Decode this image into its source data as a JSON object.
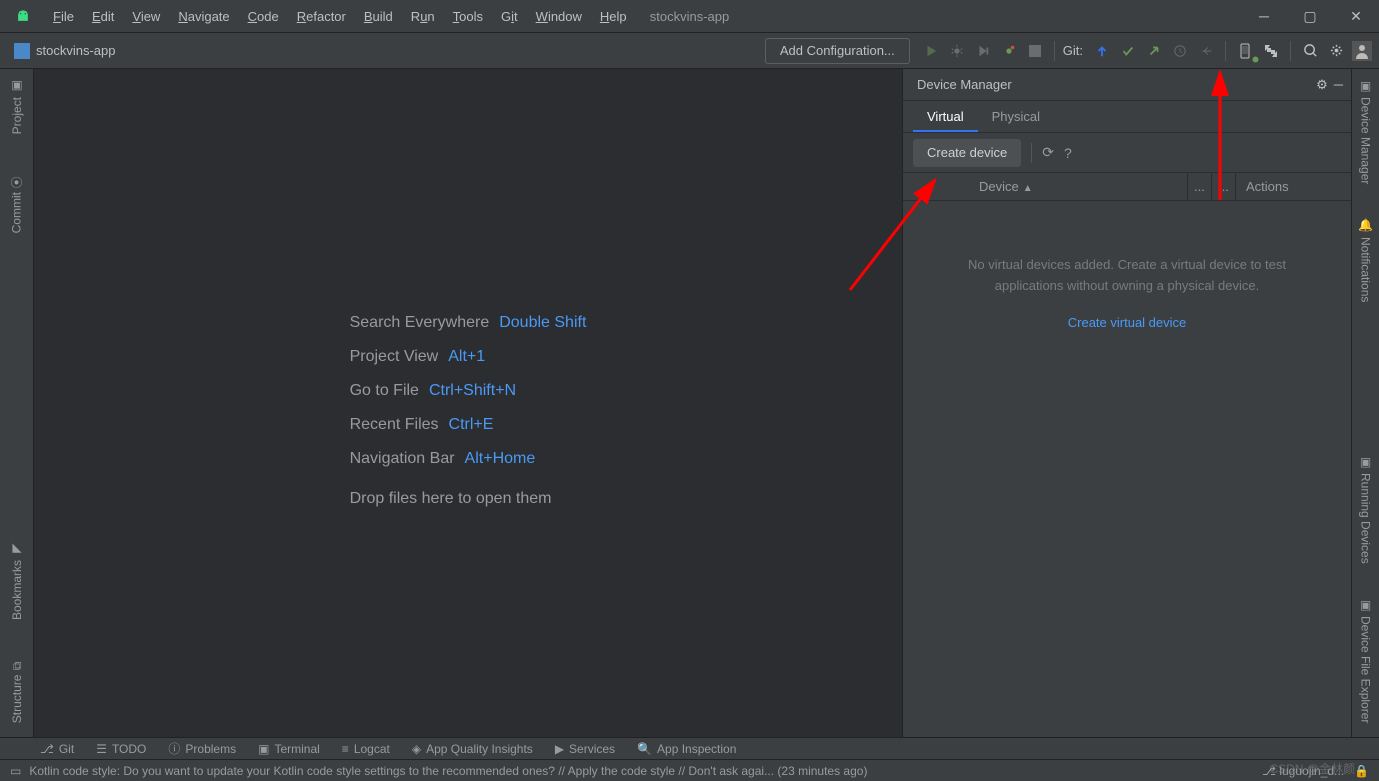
{
  "titlebar": {
    "project_title": "stockvins-app",
    "menus": [
      "File",
      "Edit",
      "View",
      "Navigate",
      "Code",
      "Refactor",
      "Build",
      "Run",
      "Tools",
      "Git",
      "Window",
      "Help"
    ]
  },
  "toolbar": {
    "project_name": "stockvins-app",
    "config_label": "Add Configuration...",
    "git_label": "Git:"
  },
  "left_tabs": {
    "project": "Project",
    "commit": "Commit",
    "bookmarks": "Bookmarks",
    "structure": "Structure"
  },
  "hints": {
    "rows": [
      {
        "label": "Search Everywhere",
        "shortcut": "Double Shift"
      },
      {
        "label": "Project View",
        "shortcut": "Alt+1"
      },
      {
        "label": "Go to File",
        "shortcut": "Ctrl+Shift+N"
      },
      {
        "label": "Recent Files",
        "shortcut": "Ctrl+E"
      },
      {
        "label": "Navigation Bar",
        "shortcut": "Alt+Home"
      }
    ],
    "drop": "Drop files here to open them"
  },
  "device_manager": {
    "title": "Device Manager",
    "tabs": {
      "virtual": "Virtual",
      "physical": "Physical"
    },
    "create_btn": "Create device",
    "col_device": "Device",
    "col_actions": "Actions",
    "empty_msg": "No virtual devices added. Create a virtual device to test applications without owning a physical device.",
    "empty_link": "Create virtual device"
  },
  "right_tabs": {
    "device_manager": "Device Manager",
    "notifications": "Notifications",
    "running": "Running Devices",
    "file_explorer": "Device File Explorer"
  },
  "bottom_tools": {
    "git": "Git",
    "todo": "TODO",
    "problems": "Problems",
    "terminal": "Terminal",
    "logcat": "Logcat",
    "quality": "App Quality Insights",
    "services": "Services",
    "inspection": "App Inspection"
  },
  "status": {
    "msg": "Kotlin code style: Do you want to update your Kotlin code style settings to the recommended ones? // Apply the code style // Don't ask agai... (23 minutes ago)",
    "branch": "luguojin_d..."
  },
  "watermark": "CSDN @金林颜"
}
